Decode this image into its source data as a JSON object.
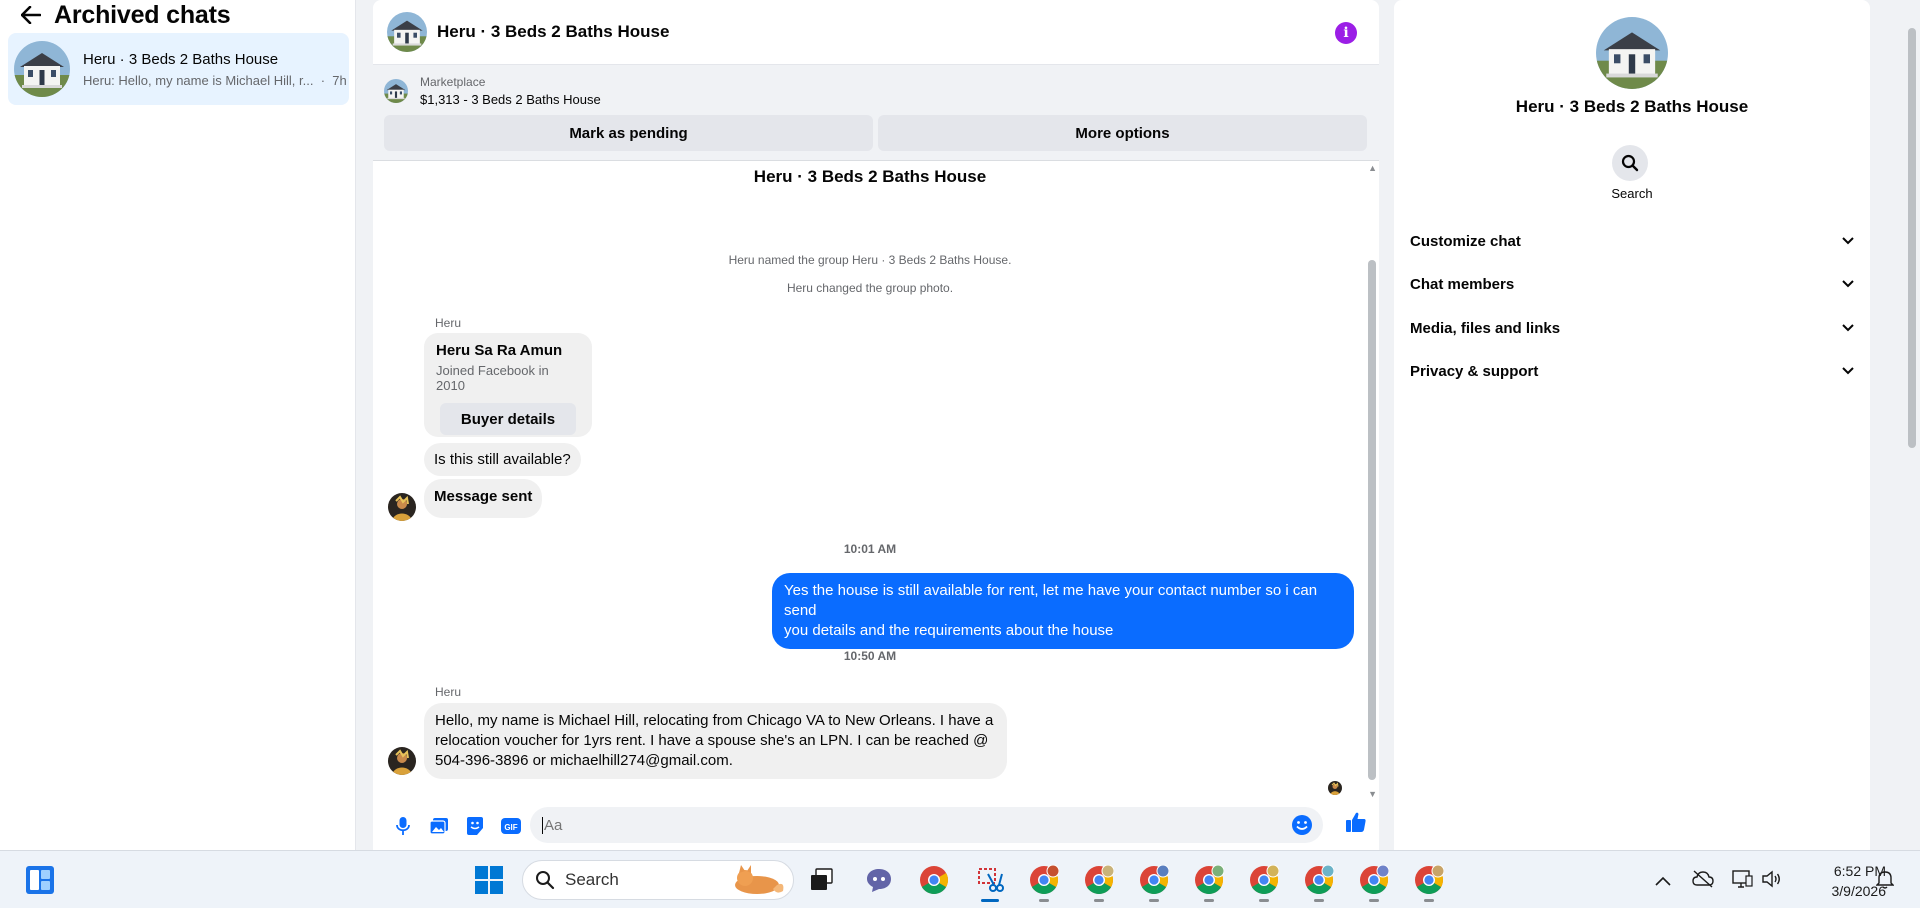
{
  "sidebar": {
    "title": "Archived chats",
    "chat": {
      "name": "Heru · 3 Beds 2 Baths House",
      "preview": "Heru: Hello, my name is Michael Hill, r...",
      "time": "7h"
    }
  },
  "conversation": {
    "title": "Heru · 3 Beds 2 Baths House",
    "marketplace": {
      "label": "Marketplace",
      "listing": "$1,313 - 3 Beds 2 Baths House",
      "pending_button": "Mark as pending",
      "more_button": "More options"
    },
    "thread_title": "Heru · 3 Beds 2 Baths House",
    "system_messages": [
      "Heru named the group Heru · 3 Beds 2 Baths House.",
      "Heru changed the group photo."
    ],
    "sender": "Heru",
    "buyer_card": {
      "name": "Heru Sa Ra Amun",
      "joined": "Joined Facebook in 2010",
      "button": "Buyer details"
    },
    "msg_available": "Is this still available?",
    "msg_sent": "Message sent",
    "time_1": "10:01 AM",
    "reply_line_1": "Yes the house is still available for rent, let me have your contact number so i can send",
    "reply_line_2": "you details and the requirements about the house",
    "time_2": "10:50 AM",
    "sender_2": "Heru",
    "last_line_1": "Hello, my name is Michael Hill, relocating from Chicago VA to New Orleans. I have a",
    "last_line_2": "relocation voucher for 1yrs rent. I have a spouse she's an LPN. I can be reached @",
    "last_line_3": "504-396-3896 or michaelhill274@gmail.com.",
    "composer_placeholder": "Aa"
  },
  "right_panel": {
    "name": "Heru · 3 Beds 2 Baths House",
    "search_label": "Search",
    "sections": [
      "Customize chat",
      "Chat members",
      "Media, files and links",
      "Privacy & support"
    ]
  },
  "taskbar": {
    "search_label": "Search",
    "time": "6:52 PM",
    "date": "3/9/2026"
  },
  "colors": {
    "accent": "#0a6cff",
    "info": "#9b1ee6",
    "selected_chat": "#e7f3ff"
  }
}
